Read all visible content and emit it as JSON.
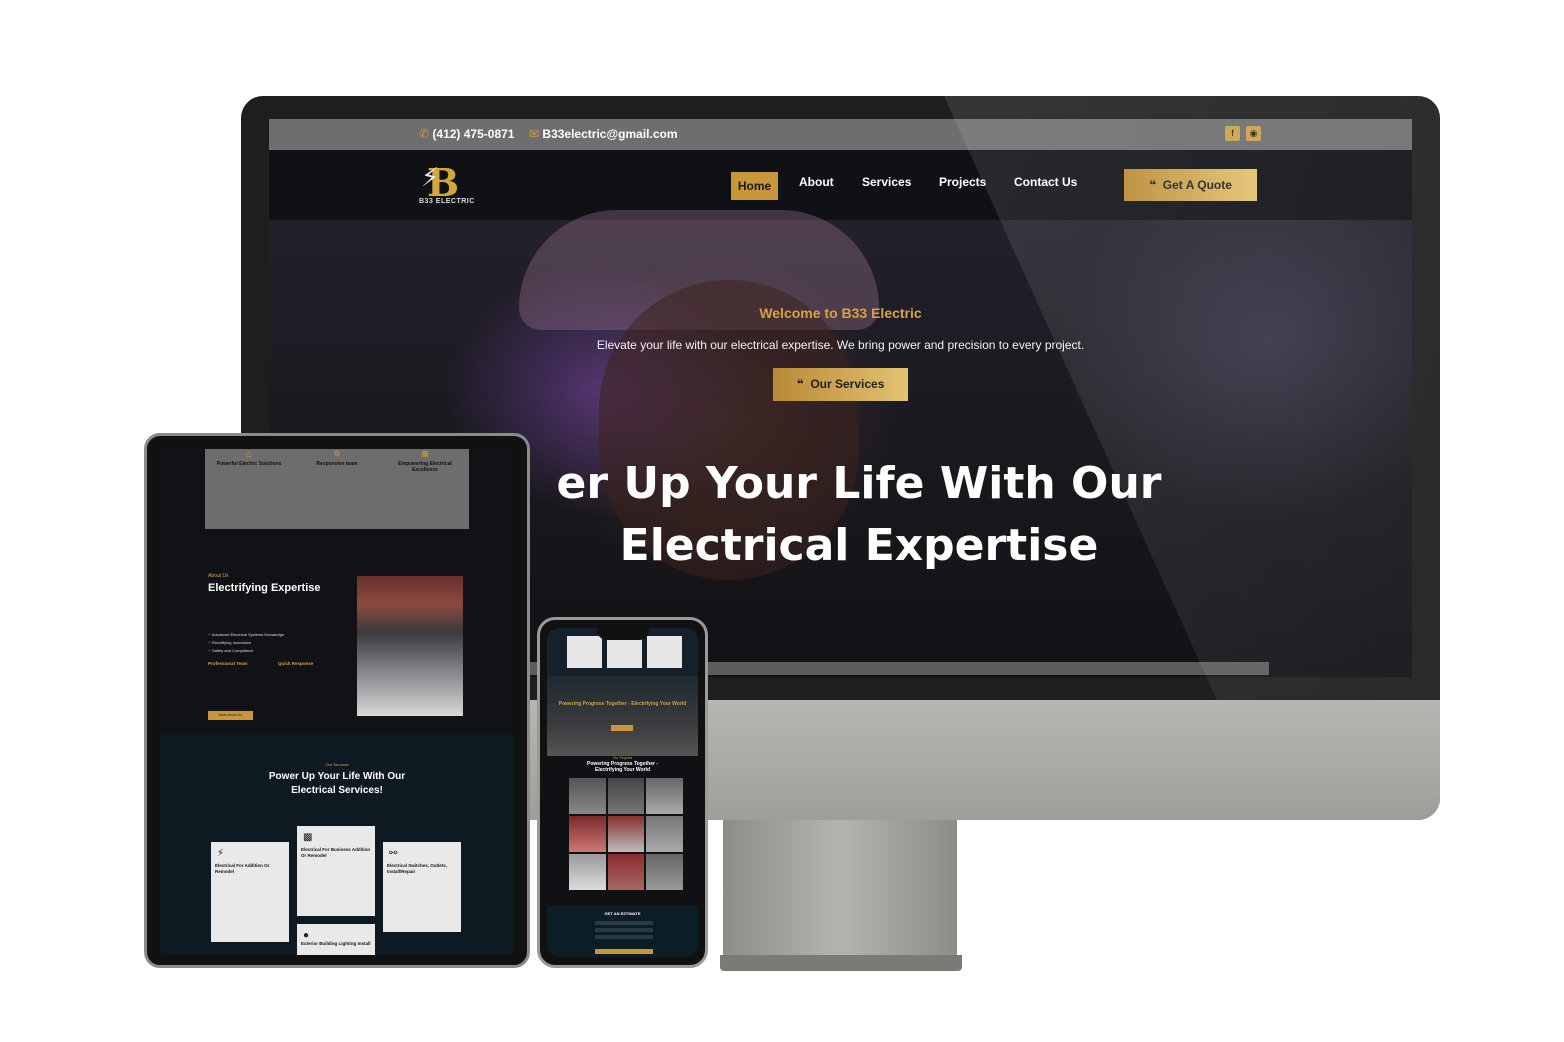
{
  "desktop": {
    "topbar": {
      "phone": "(412) 475-0871",
      "email": "B33electric@gmail.com",
      "social_icons": [
        "facebook-icon",
        "instagram-icon"
      ]
    },
    "logo": {
      "mark": "B",
      "text": "B33 ELECTRIC"
    },
    "nav": {
      "items": [
        "Home",
        "About",
        "Services",
        "Projects",
        "Contact Us"
      ],
      "active": "Home",
      "cta": "Get A Quote"
    },
    "hero": {
      "welcome": "Welcome to B33 Electric",
      "tagline": "Elevate your life with our electrical expertise. We bring power and precision to every project.",
      "button": "Our Services",
      "headline": "er Up Your Life With Our Electrical Expertise"
    }
  },
  "tablet": {
    "features": [
      {
        "title": "Powerful Electric Solutions"
      },
      {
        "title": "Responsive team"
      },
      {
        "title": "Empowering Electrical Excellence"
      }
    ],
    "about": {
      "label": "About Us",
      "title": "Electrifying Expertise",
      "bullets": [
        "Advanced Electrical Systems Knowledge",
        "Electrifying Innovation",
        "Safety and Compliance"
      ],
      "col1_title": "Professional Team",
      "col2_title": "Quick Response",
      "button": "More About Us"
    },
    "services": {
      "label": "Our Services",
      "title": "Power Up Your Life With Our Electrical Services!",
      "cards": [
        {
          "title": "Electrical For Addition Or Remodel"
        },
        {
          "title": "Electrical For Business Addition Or Remodel"
        },
        {
          "title": "Electrical Switches, Outlets, Install/Repair"
        },
        {
          "title": "Exterior Building Lighting Install"
        }
      ]
    }
  },
  "phone": {
    "hero_title": "Powering Progress Together - Electrifying Your World",
    "projects_label": "Our Projects",
    "projects_title": "Powering Progress Together - Electrifying Your World",
    "estimate_title": "GET AN ESTIMATE"
  },
  "colors": {
    "accent": "#c9963a",
    "dark": "#0f1115",
    "topbar": "#6e6e6e"
  }
}
